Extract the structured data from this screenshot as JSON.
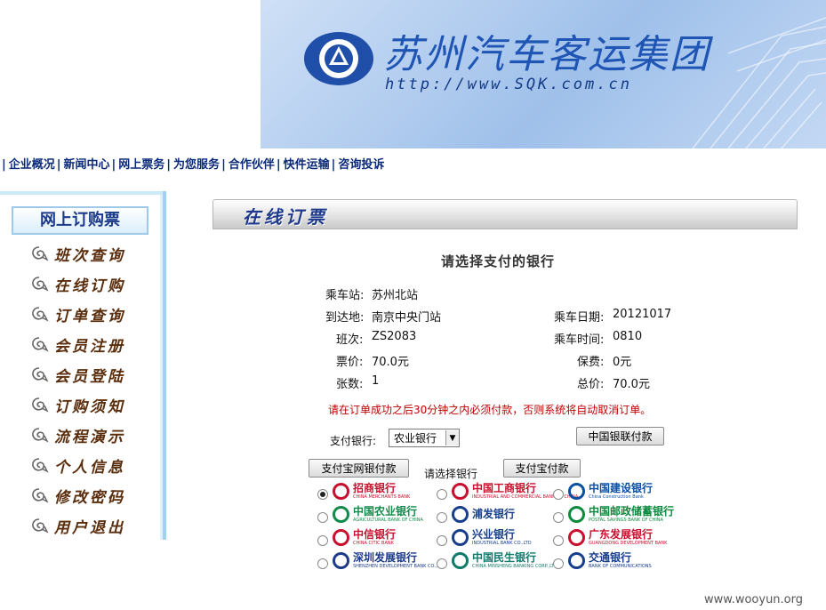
{
  "banner": {
    "title": "苏州汽车客运集团",
    "url": "http://www.SQK.com.cn"
  },
  "nav": [
    {
      "label": "企业概况"
    },
    {
      "label": "新闻中心"
    },
    {
      "label": "网上票务"
    },
    {
      "label": "为您服务"
    },
    {
      "label": "合作伙伴"
    },
    {
      "label": "快件运输"
    },
    {
      "label": "咨询投诉"
    }
  ],
  "sidebar": {
    "title": "网上订购票",
    "items": [
      {
        "label": "班次查询"
      },
      {
        "label": "在线订购"
      },
      {
        "label": "订单查询"
      },
      {
        "label": "会员注册"
      },
      {
        "label": "会员登陆"
      },
      {
        "label": "订购须知"
      },
      {
        "label": "流程演示"
      },
      {
        "label": "个人信息"
      },
      {
        "label": "修改密码"
      },
      {
        "label": "用户退出"
      }
    ]
  },
  "header": {
    "title": "在线订票"
  },
  "main": {
    "heading": "请选择支付的银行",
    "fields": {
      "departure_label": "乘车站:",
      "departure": "苏州北站",
      "destination_label": "到达地:",
      "destination": "南京中央门站",
      "date_label": "乘车日期:",
      "date": "20121017",
      "shift_label": "班次:",
      "shift": "ZS2083",
      "time_label": "乘车时间:",
      "time": "0810",
      "price_label": "票价:",
      "price": "70.0元",
      "insurance_label": "保费:",
      "insurance": "0元",
      "count_label": "张数:",
      "count": "1",
      "total_label": "总价:",
      "total": "70.0元"
    },
    "notice": "请在订单成功之后30分钟之内必须付款，否则系统将自动取消订单。",
    "pay_bank_label": "支付银行:",
    "pay_bank_selected": "农业银行",
    "unionpay_button": "中国银联付款",
    "alipay_bank_button": "支付宝网银付款",
    "choose_bank_label": "请选择银行",
    "alipay_button": "支付宝付款",
    "banks": [
      {
        "name": "招商银行",
        "sub": "CHINA MERCHANTS BANK",
        "color": "#c8102e",
        "selected": true
      },
      {
        "name": "中国工商银行",
        "sub": "INDUSTRIAL AND COMMERCIAL BANK OF CHINA",
        "color": "#c8102e",
        "selected": false
      },
      {
        "name": "中国建设银行",
        "sub": "China Construction Bank",
        "color": "#0b4ea2",
        "selected": false
      },
      {
        "name": "中国农业银行",
        "sub": "AGRICULTURAL BANK OF CHINA",
        "color": "#118a4a",
        "selected": false
      },
      {
        "name": "浦发银行",
        "sub": "",
        "color": "#173e8c",
        "selected": false
      },
      {
        "name": "中国邮政储蓄银行",
        "sub": "POSTAL SAVINGS BANK OF CHINA",
        "color": "#0b8a3e",
        "selected": false
      },
      {
        "name": "中信银行",
        "sub": "CHINA CITIC BANK",
        "color": "#c8102e",
        "selected": false
      },
      {
        "name": "兴业银行",
        "sub": "INDUSTRIAL BANK CO.,LTD",
        "color": "#173e8c",
        "selected": false
      },
      {
        "name": "广东发展银行",
        "sub": "GUANGDONG DEVELOPMENT BANK",
        "color": "#c8102e",
        "selected": false
      },
      {
        "name": "深圳发展银行",
        "sub": "SHENZHEN DEVELOPMENT BANK CO.,LTD.",
        "color": "#1b3a8a",
        "selected": false
      },
      {
        "name": "中国民生银行",
        "sub": "CHINA MINSHENG BANKING CORP.,LTD.",
        "color": "#0e7a6a",
        "selected": false
      },
      {
        "name": "交通银行",
        "sub": "BANK OF COMMUNICATIONS",
        "color": "#173e8c",
        "selected": false
      }
    ]
  },
  "watermark": "www.wooyun.org"
}
